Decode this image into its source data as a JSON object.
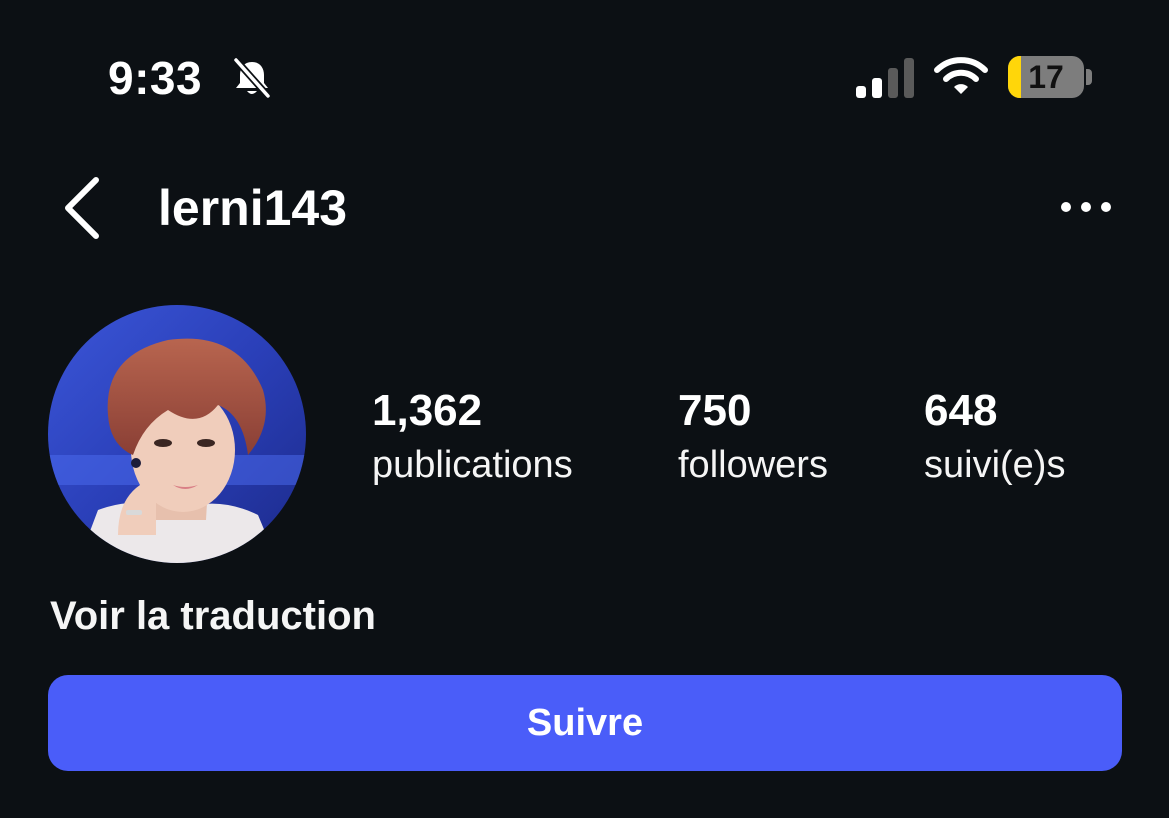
{
  "status_bar": {
    "time": "9:33",
    "silent_icon": "bell-slash-icon",
    "signal_icon": "cellular-signal-icon",
    "signal_level": 0.5,
    "wifi_icon": "wifi-icon",
    "battery_level": "17",
    "battery_fraction": 0.17,
    "battery_fill_color": "#ffd60a"
  },
  "header": {
    "back_icon": "chevron-left-icon",
    "username": "lerni143",
    "more_icon": "ellipsis-icon"
  },
  "profile": {
    "avatar_icon": "profile-photo",
    "stats": [
      {
        "count": "1,362",
        "label": "publications"
      },
      {
        "count": "750",
        "label": "followers"
      },
      {
        "count": "648",
        "label": "suivi(e)s"
      }
    ],
    "translate_label": "Voir la traduction"
  },
  "actions": {
    "follow_label": "Suivre",
    "follow_color": "#4a5df9"
  },
  "colors": {
    "background": "#0c1014",
    "text": "#f5f5f5"
  }
}
